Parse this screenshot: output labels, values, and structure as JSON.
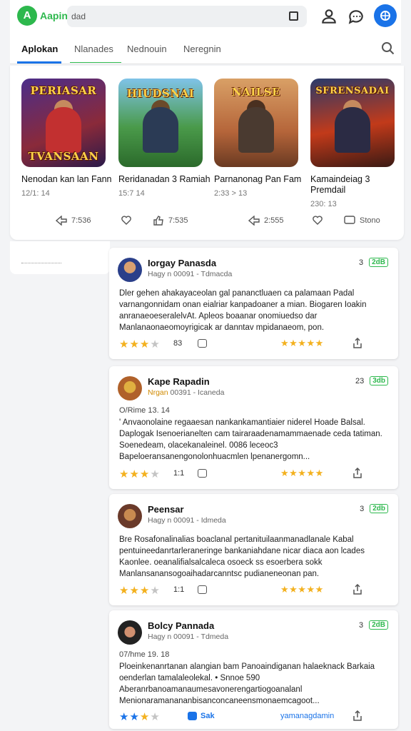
{
  "header": {
    "app_name": "Aapin",
    "logo_letter": "A",
    "search_text": "dad",
    "icons": [
      "logo-icon",
      "fullscreen-icon",
      "account-icon",
      "chat-icon",
      "profile-avatar-icon"
    ]
  },
  "tabs": [
    {
      "label": "Aplokan",
      "active": true
    },
    {
      "label": "Nlanades",
      "active": false
    },
    {
      "label": "Nednouin",
      "active": false
    },
    {
      "label": "Neregnin",
      "active": false
    }
  ],
  "games": [
    {
      "thumb_title_top": "PERIASAR",
      "thumb_title_bottom": "TVANSAAN",
      "name": "Nenodan kan lan Fann",
      "meta": "12/1: 14",
      "bg": "#3a2a6a",
      "accent": "#d23a3a"
    },
    {
      "thumb_title_top": "HIUDSNAI",
      "thumb_title_bottom": "",
      "name": "Reridanadan 3 Ramiah",
      "meta": "15:7 14",
      "bg": "#3c8a4a",
      "accent": "#2b3b55"
    },
    {
      "thumb_title_top": "NAILSE",
      "thumb_title_bottom": "",
      "name": "Parnanonag Pan Fam",
      "meta": "2:33 > 13",
      "bg": "#c7874a",
      "accent": "#5a3a2a"
    },
    {
      "thumb_title_top": "SFRENSADAI",
      "thumb_title_bottom": "",
      "name": "Kamaindeiag 3 Premdail",
      "meta": "230: 13",
      "bg": "#a2321c",
      "accent": "#2b2b44"
    }
  ],
  "game_actions": [
    {
      "label": "7:536"
    },
    {
      "label": ""
    },
    {
      "label": "7:535"
    },
    {
      "label": "2:555"
    },
    {
      "label": ""
    },
    {
      "label": "Stono"
    }
  ],
  "reviews": [
    {
      "name": "Iorgay Panasda",
      "sub": "Hagy n 00091 - Tdmacda",
      "sub_highlight": "",
      "badge_num": "3",
      "badge_tag": "2dB",
      "date": "",
      "body": "Dler gehen ahakayaceolan gal pananctluaen ca palamaan Padal varnangonnidam onan eialriar kanpadoaner a mian. Biogaren Ioakin anranaeoeseralelvAt. Apleos boaanar onomiuedso dar Manlanaonaeomoyrigicak ar danntav mpidanaeom, pon.",
      "rating": 3,
      "count": "83",
      "right_stars": "★★★★★",
      "right_link": "",
      "avatar_bg": "#2a3f8a"
    },
    {
      "name": "Kape Rapadin",
      "sub": "00391 - Icaneda",
      "sub_highlight": "Nrgan",
      "badge_num": "23",
      "badge_tag": "3db",
      "date": "O/Rime 13. 14",
      "body": "' Anvaonolaine regaaesan nankankamantiaier niderel Hoade Balsal. Daplogak Isenoerianelten cam tairaraadenamammaenade ceda tatiman. Soenedeam, olacekanaleinel. 0086 leceoc3 Bapeloeransanengonolonhuacmlen lpenanergomn...",
      "rating": 3,
      "count": "1:1",
      "right_stars": "★★★★★",
      "right_link": "",
      "avatar_bg": "#b0612a"
    },
    {
      "name": "Peensar",
      "sub": "Hagy n 00091 - Idmeda",
      "sub_highlight": "",
      "badge_num": "3",
      "badge_tag": "2db",
      "date": "",
      "body": "Bre Rosafonalinalias boaclanal pertanituilaanmanadlanale Kabal pentuineedanrtarleraneringe bankaniahdane nicar diaca aon lcades Kaonlee. oeanalifialsalcaleca osoeck ss esoerbera sokk Manlansanansogoaihadarcanntsc pudianeneonan pan.",
      "rating": 3,
      "count": "1:1",
      "right_stars": "★★★★★",
      "right_link": "",
      "avatar_bg": "#6a3a2a"
    },
    {
      "name": "Bolcy Pannada",
      "sub": "Hagy n 00091 - Tdmeda",
      "sub_highlight": "",
      "badge_num": "3",
      "badge_tag": "2dB",
      "date": "07/hme 19. 18",
      "body": "Ploeinkenanrtanan alangian bam Panoaindiganan halaeknack Barkaia oenderlan tamalaleolekal. • Snnoe 590 Aberanrbanoamanaumesavonerengartiogoanalanl Menionaramanananbisanconcaneensmonaemcagoot...",
      "rating": 2,
      "count": "",
      "right_stars": "",
      "right_link": "yamanagdamin",
      "blue_label": "Sak",
      "avatar_bg": "#222"
    }
  ],
  "colors": {
    "brand": "#2db84d",
    "accent": "#1a73e8",
    "star": "#f3b11f"
  }
}
